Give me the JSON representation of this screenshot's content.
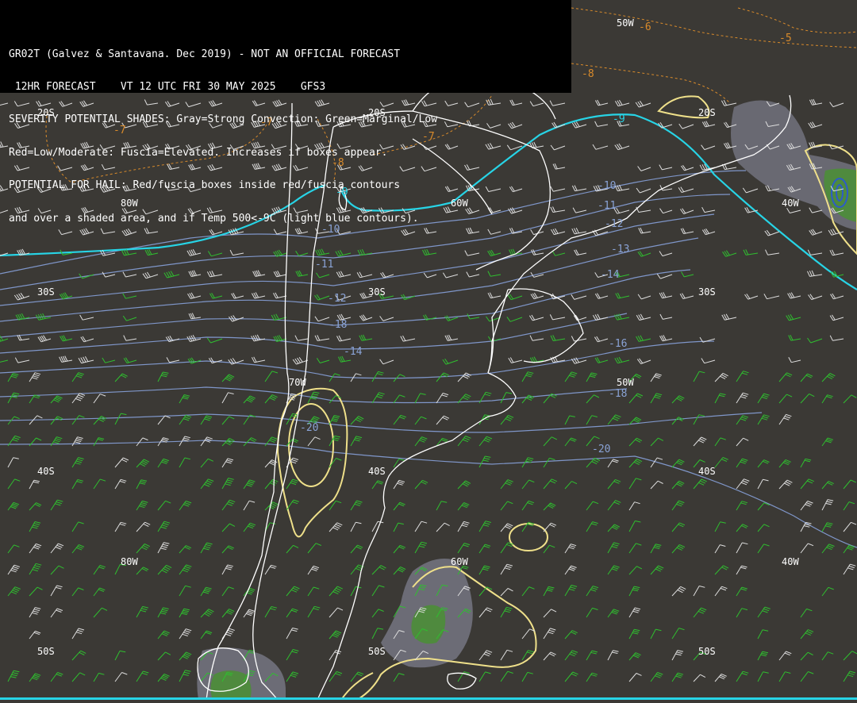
{
  "header": {
    "line1": "GR02T (Galvez & Santavana. Dec 2019) - NOT AN OFFICIAL FORECAST",
    "line2": " 12HR FORECAST    VT 12 UTC FRI 30 MAY 2025    GFS3",
    "line3": "SEVERITY POTENTIAL SHADES: Gray=Strong Convection: Green=Marginal/Low",
    "line4": "Red=Low/Moderate: Fuscia=Elevated. Increases if boxes appear.",
    "line5": "POTENTIAL FOR HAIL: Red/fuscia boxes inside red/fuscia contours",
    "line6": "and over a shaded area, and if Temp 500<-9C (light blue contours)."
  },
  "grid_labels": {
    "lat20_left": "20S",
    "lat20_mid": "20S",
    "lat20_right": "20S",
    "lat30_left": "30S",
    "lat30_mid": "30S",
    "lat30_right": "30S",
    "lat40_left": "40S",
    "lat40_mid": "40S",
    "lat40_right": "40S",
    "lat50_left": "50S",
    "lat50_mid": "50S",
    "lat50_right": "50S",
    "lon80_top": "80W",
    "lon80_bot": "80W",
    "lon70": "70W",
    "lon60_top": "60W",
    "lon60_bot": "60W",
    "lon50_top": "50W",
    "lon50_mid": "50W",
    "lon40_top": "40W",
    "lon40_bot": "40W"
  },
  "temp_labels": {
    "t10a": "-10",
    "t10b": "-10",
    "t11a": "-11",
    "t11b": "-11",
    "t12a": "-12",
    "t12b": "-12",
    "t13": "-13",
    "t14a": "-14",
    "t14b": "-14",
    "t16": "-16",
    "t18a": "-18",
    "t18b": "-18",
    "t20a": "-20",
    "t20b": "-20"
  },
  "orange_labels": {
    "o6": "-6",
    "o5": "-5",
    "o8": "-8",
    "o7a": "-7",
    "o7b": "-7",
    "o7c": "-7",
    "o8b": "-8"
  },
  "cyan_labels": {
    "c9a": "-9",
    "c9b": "-9"
  },
  "colors": {
    "background": "#3b3935",
    "coastline": "#ffffff",
    "temp_contour": "#7f96c9",
    "cold_contour": "#27d4e6",
    "orange_contour": "#d98b2b",
    "yellow_contour": "#efe08a",
    "convection_gray": "#6e6e78",
    "marginal_green": "#4f8a3e",
    "wind_barb_green": "#2fbf2f",
    "wind_barb_white": "#dedede"
  }
}
